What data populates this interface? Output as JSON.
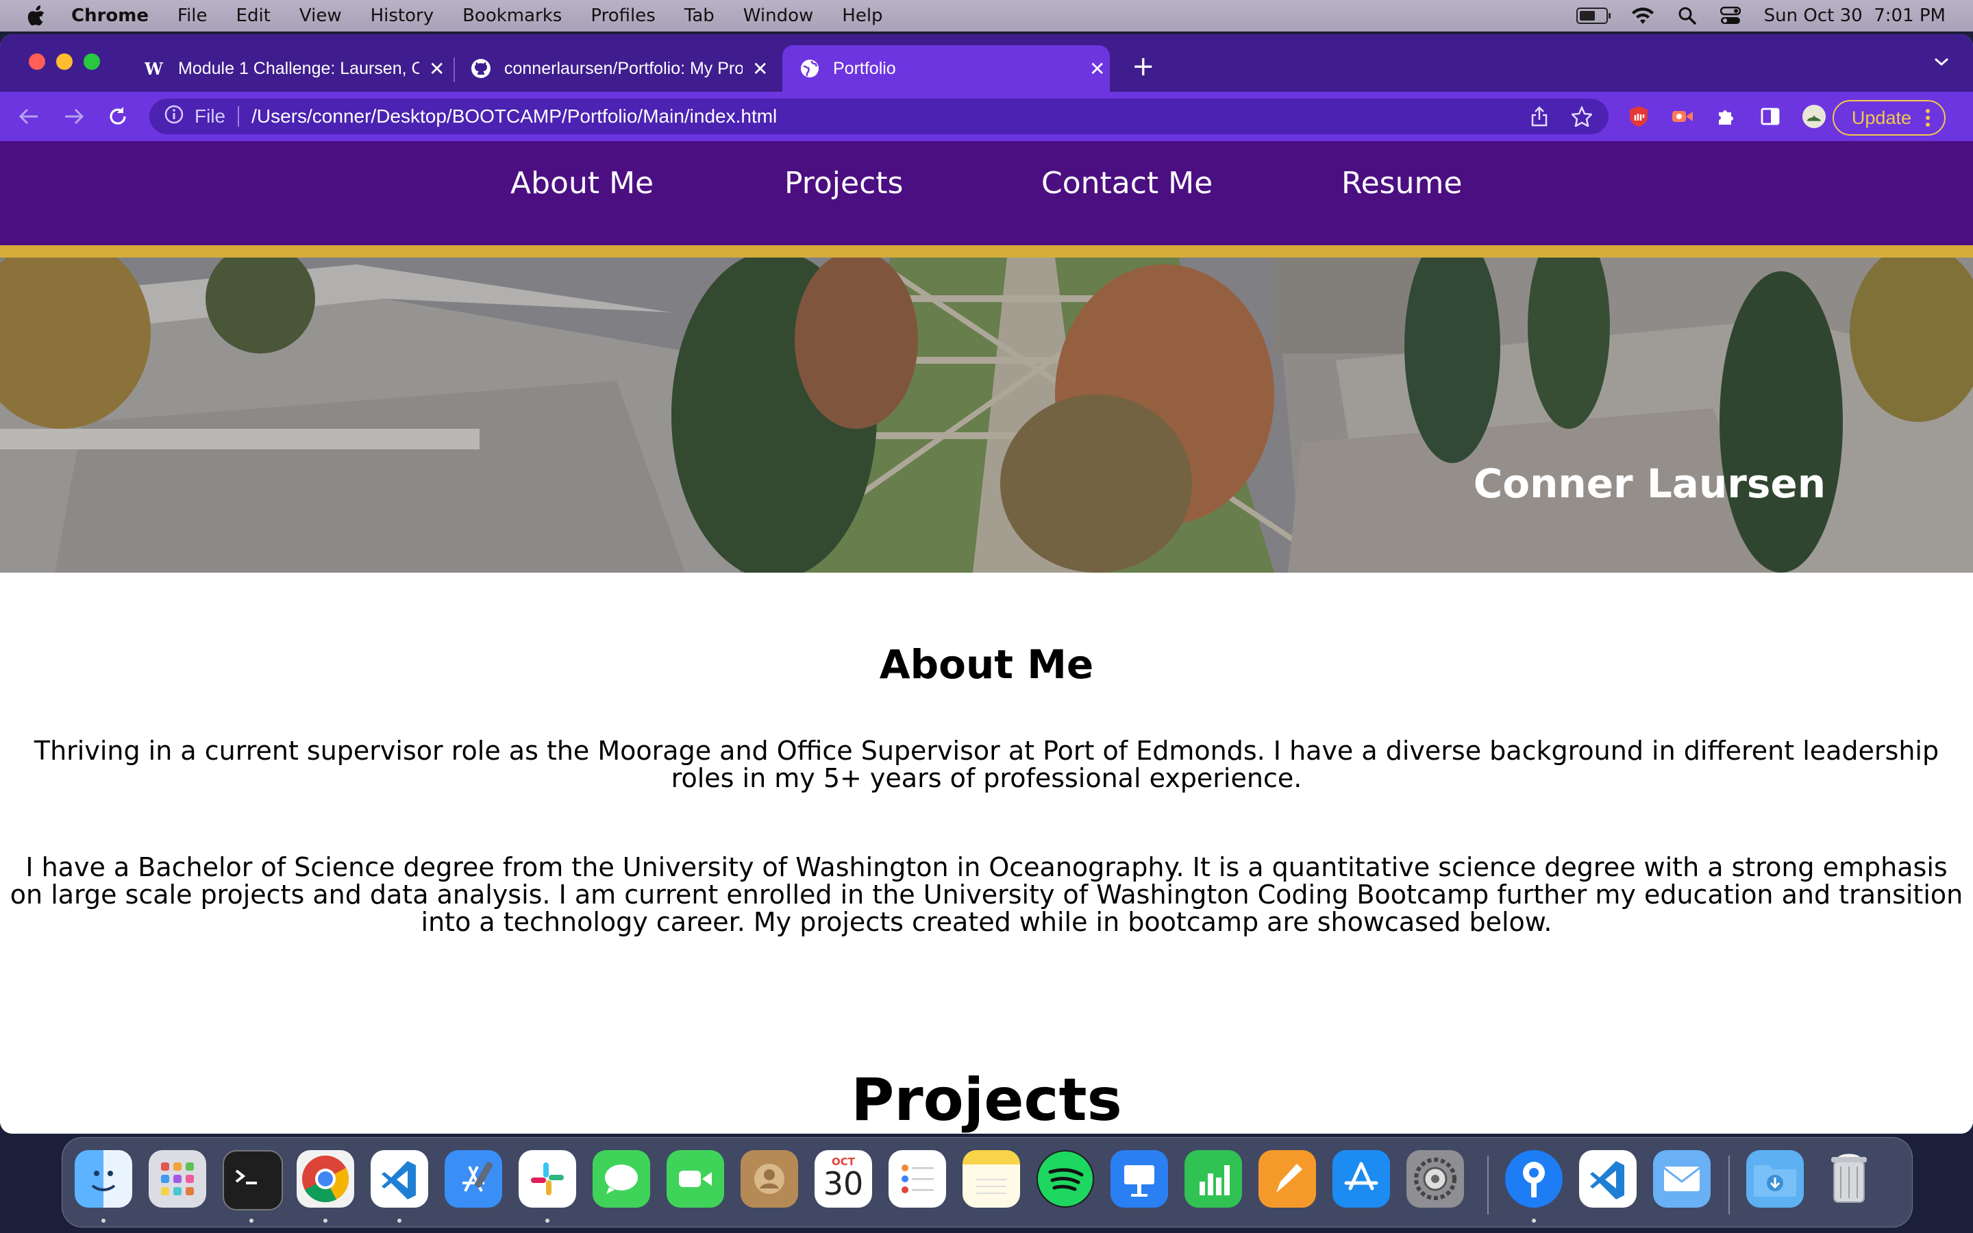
{
  "menubar": {
    "app": "Chrome",
    "items": [
      "File",
      "Edit",
      "View",
      "History",
      "Bookmarks",
      "Profiles",
      "Tab",
      "Window",
      "Help"
    ],
    "datetime": "Sun Oct 30  7:01 PM"
  },
  "browser": {
    "tabs": [
      {
        "title": "Module 1 Challenge: Laursen, C",
        "icon": "w-logo-icon"
      },
      {
        "title": "connerlaursen/Portfolio: My Pro",
        "icon": "github-icon"
      },
      {
        "title": "Portfolio",
        "icon": "globe-icon",
        "active": true
      }
    ],
    "address": {
      "scheme": "File",
      "url": "/Users/conner/Desktop/BOOTCAMP/Portfolio/Main/index.html"
    },
    "update_label": "Update",
    "accent": "#6d35e0"
  },
  "site": {
    "nav": [
      "About Me",
      "Projects",
      "Contact Me",
      "Resume"
    ],
    "hero_name": "Conner Laursen",
    "about": {
      "title": "About Me",
      "p1": "Thriving in a current supervisor role as the Moorage and Office Supervisor at Port of Edmonds. I have a diverse background in different leadership roles in my 5+ years of professional experience.",
      "p2": "I have a Bachelor of Science degree from the University of Washington in Oceanography. It is a quantitative science degree with a strong emphasis on large scale projects and data analysis. I am current enrolled in the University of Washington Coding Bootcamp further my education and transition into a technology career. My projects created while in bootcamp are showcased below."
    },
    "projects_title": "Projects",
    "colors": {
      "nav": "#4b0f82",
      "gold": "#d5ad3b"
    }
  },
  "dock": {
    "calendar_month": "OCT",
    "calendar_day": "30",
    "apps": [
      "finder-icon",
      "launchpad-icon",
      "terminal-icon",
      "chrome-icon",
      "vscode-icon",
      "xcode-icon",
      "slack-icon",
      "messages-icon",
      "facetime-icon",
      "contacts-icon",
      "calendar-icon",
      "reminders-icon",
      "notes-icon",
      "spotify-icon",
      "keynote-icon",
      "numbers-icon",
      "pages-icon",
      "app-store-icon",
      "system-preferences-icon",
      "sourcetree-icon",
      "vscode-insiders-icon",
      "mail-icon",
      "downloads-folder-icon",
      "trash-icon"
    ]
  }
}
